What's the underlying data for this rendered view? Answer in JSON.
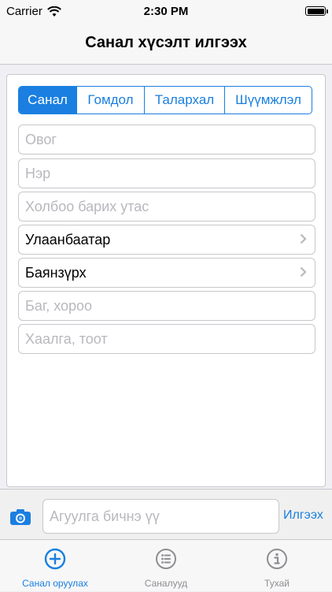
{
  "status_bar": {
    "carrier": "Carrier",
    "time": "2:30 PM",
    "battery_level": 1.0
  },
  "nav": {
    "title": "Санал хүсэлт илгээх"
  },
  "segments": [
    {
      "label": "Санал",
      "active": true
    },
    {
      "label": "Гомдол",
      "active": false
    },
    {
      "label": "Талархал",
      "active": false
    },
    {
      "label": "Шүүмжлэл",
      "active": false
    }
  ],
  "form": {
    "surname_placeholder": "Овог",
    "name_placeholder": "Нэр",
    "phone_placeholder": "Холбоо барих утас",
    "city_value": "Улаанбаатар",
    "district_value": "Баянзүрх",
    "khoroo_placeholder": "Баг, хороо",
    "door_placeholder": "Хаалга, тоот"
  },
  "compose": {
    "placeholder": "Агуулга бичнэ үү",
    "send_label": "Илгээх"
  },
  "tabs": [
    {
      "label": "Санал оруулах",
      "icon": "plus-circle-icon",
      "active": true
    },
    {
      "label": "Саналууд",
      "icon": "list-icon",
      "active": false
    },
    {
      "label": "Тухай",
      "icon": "info-icon",
      "active": false
    }
  ],
  "colors": {
    "accent": "#1a7fe0",
    "inactive": "#8e8e93",
    "border": "#c8c7cc"
  }
}
